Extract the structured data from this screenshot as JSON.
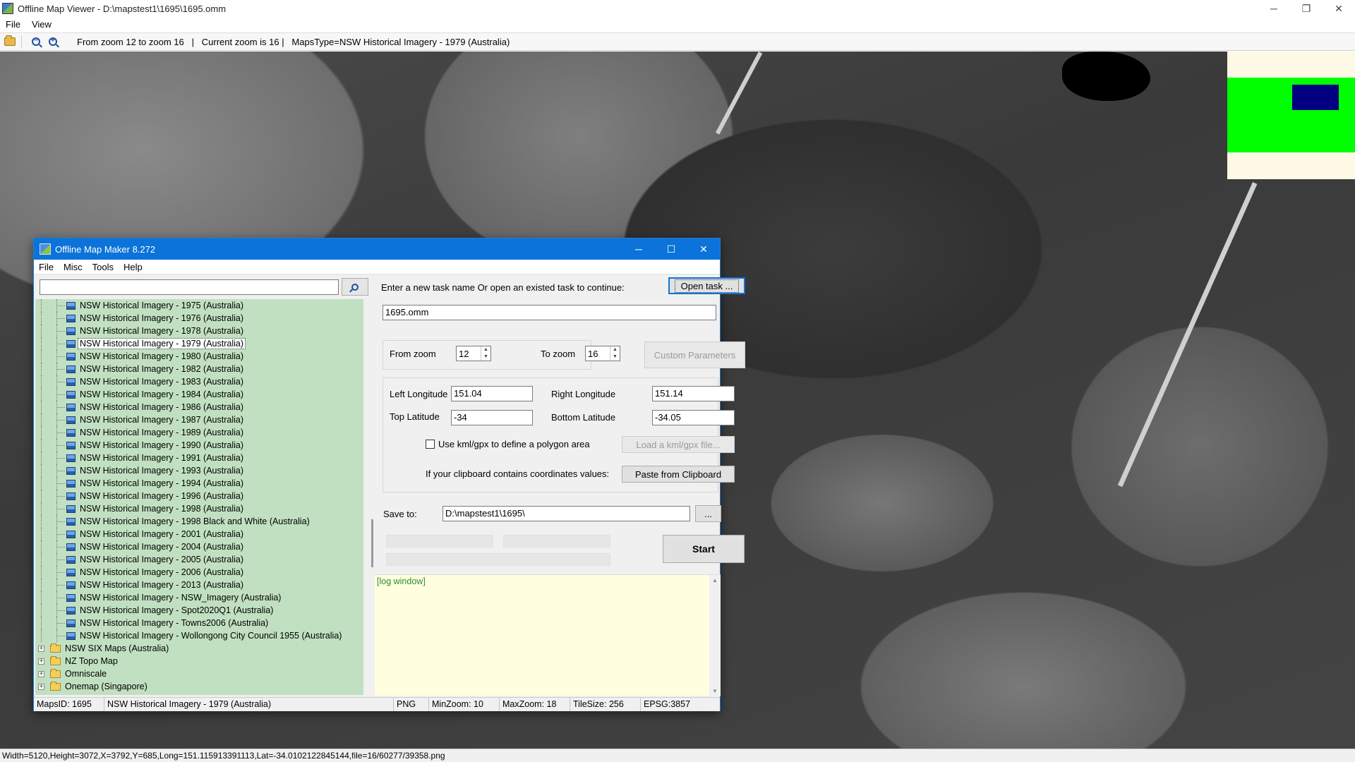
{
  "viewer": {
    "title": "Offline Map Viewer - D:\\mapstest1\\1695\\1695.omm",
    "menu": [
      "File",
      "View"
    ],
    "toolbar_info": "From zoom 12 to zoom 16   |   Current zoom is 16 |   MapsType=NSW Historical Imagery - 1979 (Australia)",
    "window_controls": {
      "minimize": "─",
      "maximize": "❐",
      "close": "✕"
    },
    "status": "Width=5120,Height=3072,X=3792,Y=685,Long=151.115913391113,Lat=-34.0102122845144,file=16/60277/39358.png"
  },
  "overview_colors": {
    "background": "#fdf9e4",
    "area": "#00ff00",
    "viewport": "#000080"
  },
  "maker": {
    "title": "Offline Map Maker 8.272",
    "menu": [
      "File",
      "Misc",
      "Tools",
      "Help"
    ],
    "window_controls": {
      "minimize": "─",
      "maximize": "☐",
      "close": "✕"
    },
    "search": {
      "value": ""
    },
    "tree": {
      "leaves": [
        "NSW Historical Imagery - 1975 (Australia)",
        "NSW Historical Imagery - 1976 (Australia)",
        "NSW Historical Imagery - 1978 (Australia)",
        "NSW Historical Imagery - 1979 (Australia)",
        "NSW Historical Imagery - 1980 (Australia)",
        "NSW Historical Imagery - 1982 (Australia)",
        "NSW Historical Imagery - 1983 (Australia)",
        "NSW Historical Imagery - 1984 (Australia)",
        "NSW Historical Imagery - 1986 (Australia)",
        "NSW Historical Imagery - 1987 (Australia)",
        "NSW Historical Imagery - 1989 (Australia)",
        "NSW Historical Imagery - 1990 (Australia)",
        "NSW Historical Imagery - 1991 (Australia)",
        "NSW Historical Imagery - 1993 (Australia)",
        "NSW Historical Imagery - 1994 (Australia)",
        "NSW Historical Imagery - 1996 (Australia)",
        "NSW Historical Imagery - 1998 (Australia)",
        "NSW Historical Imagery - 1998 Black and White (Australia)",
        "NSW Historical Imagery - 2001 (Australia)",
        "NSW Historical Imagery - 2004 (Australia)",
        "NSW Historical Imagery - 2005 (Australia)",
        "NSW Historical Imagery - 2006 (Australia)",
        "NSW Historical Imagery - 2013 (Australia)",
        "NSW Historical Imagery - NSW_Imagery (Australia)",
        "NSW Historical Imagery - Spot2020Q1 (Australia)",
        "NSW Historical Imagery - Towns2006 (Australia)",
        "NSW Historical Imagery - Wollongong City Council 1955 (Australia)"
      ],
      "selected_leaf": "NSW Historical Imagery - 1979 (Australia)",
      "folders": [
        "NSW SIX Maps (Australia)",
        "NZ Topo Map",
        "Omniscale",
        "Onemap (Singapore)"
      ],
      "expander_symbol": "+"
    },
    "task": {
      "prompt": "Enter a new task name Or open an existed task to continue:",
      "open_button": "Open task ...",
      "name_value": "1695.omm"
    },
    "zoom": {
      "from_label": "From zoom",
      "from_value": "12",
      "to_label": "To zoom",
      "to_value": "16",
      "custom_button": "Custom Parameters",
      "spin_up": "▲",
      "spin_down": "▼"
    },
    "coords": {
      "left_lon_label": "Left Longitude",
      "left_lon_value": "151.04",
      "right_lon_label": "Right Longitude",
      "right_lon_value": "151.14",
      "top_lat_label": "Top Latitude",
      "top_lat_value": "-34",
      "bottom_lat_label": "Bottom Latitude",
      "bottom_lat_value": "-34.05",
      "kml_checkbox_label": "Use kml/gpx to define a polygon area",
      "kml_button": "Load a kml/gpx file...",
      "clipboard_label": "If your clipboard contains coordinates values:",
      "clipboard_button": "Paste from Clipboard"
    },
    "save": {
      "label": "Save to:",
      "path_value": "D:\\mapstest1\\1695\\",
      "browse_button": "..."
    },
    "start_button": "Start",
    "log": {
      "text": "[log window]",
      "scroll_up": "▲",
      "scroll_down": "▼"
    },
    "status": {
      "maps_id": "MapsID: 1695",
      "maps_name": "NSW Historical Imagery - 1979 (Australia)",
      "format": "PNG",
      "min_zoom": "MinZoom: 10",
      "max_zoom": "MaxZoom: 18",
      "tile_size": "TileSize: 256",
      "epsg": "EPSG:3857"
    }
  }
}
